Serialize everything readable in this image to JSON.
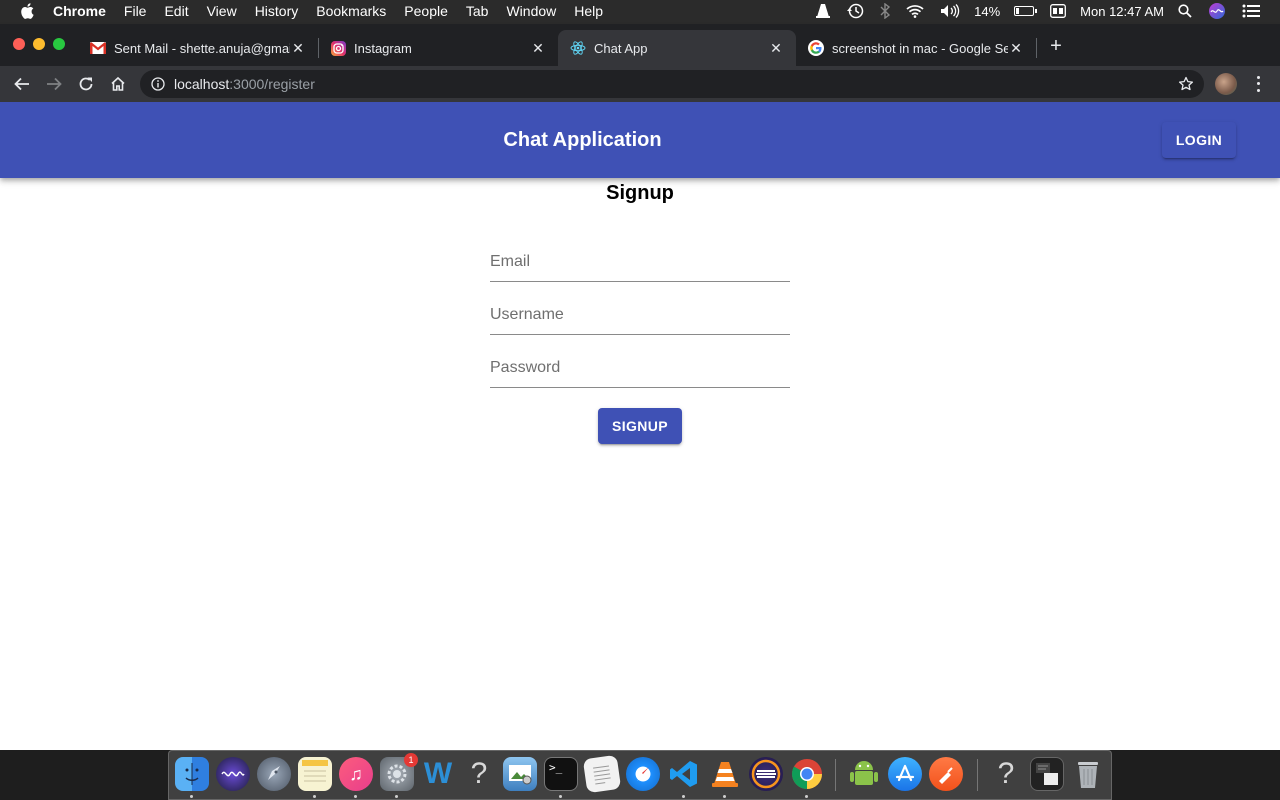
{
  "menubar": {
    "app_name": "Chrome",
    "items": [
      "File",
      "Edit",
      "View",
      "History",
      "Bookmarks",
      "People",
      "Tab",
      "Window",
      "Help"
    ],
    "battery": "14%",
    "clock": "Mon 12:47 AM"
  },
  "tabs": [
    {
      "title": "Sent Mail - shette.anuja@gmail",
      "icon": "gmail-icon"
    },
    {
      "title": "Instagram",
      "icon": "instagram-icon"
    },
    {
      "title": "Chat App",
      "icon": "react-icon",
      "active": true
    },
    {
      "title": "screenshot in mac - Google Se",
      "icon": "google-icon"
    }
  ],
  "address_bar": {
    "host": "localhost",
    "path": ":3000/register"
  },
  "app": {
    "title": "Chat Application",
    "login_label": "LOGIN",
    "heading": "Signup",
    "email_placeholder": "Email",
    "username_placeholder": "Username",
    "password_placeholder": "Password",
    "signup_label": "SIGNUP"
  },
  "dock": {
    "system_preferences_badge": "1"
  },
  "colors": {
    "primary": "#3f51b5",
    "chrome_dark": "#202124",
    "chrome_toolbar": "#35363a"
  }
}
